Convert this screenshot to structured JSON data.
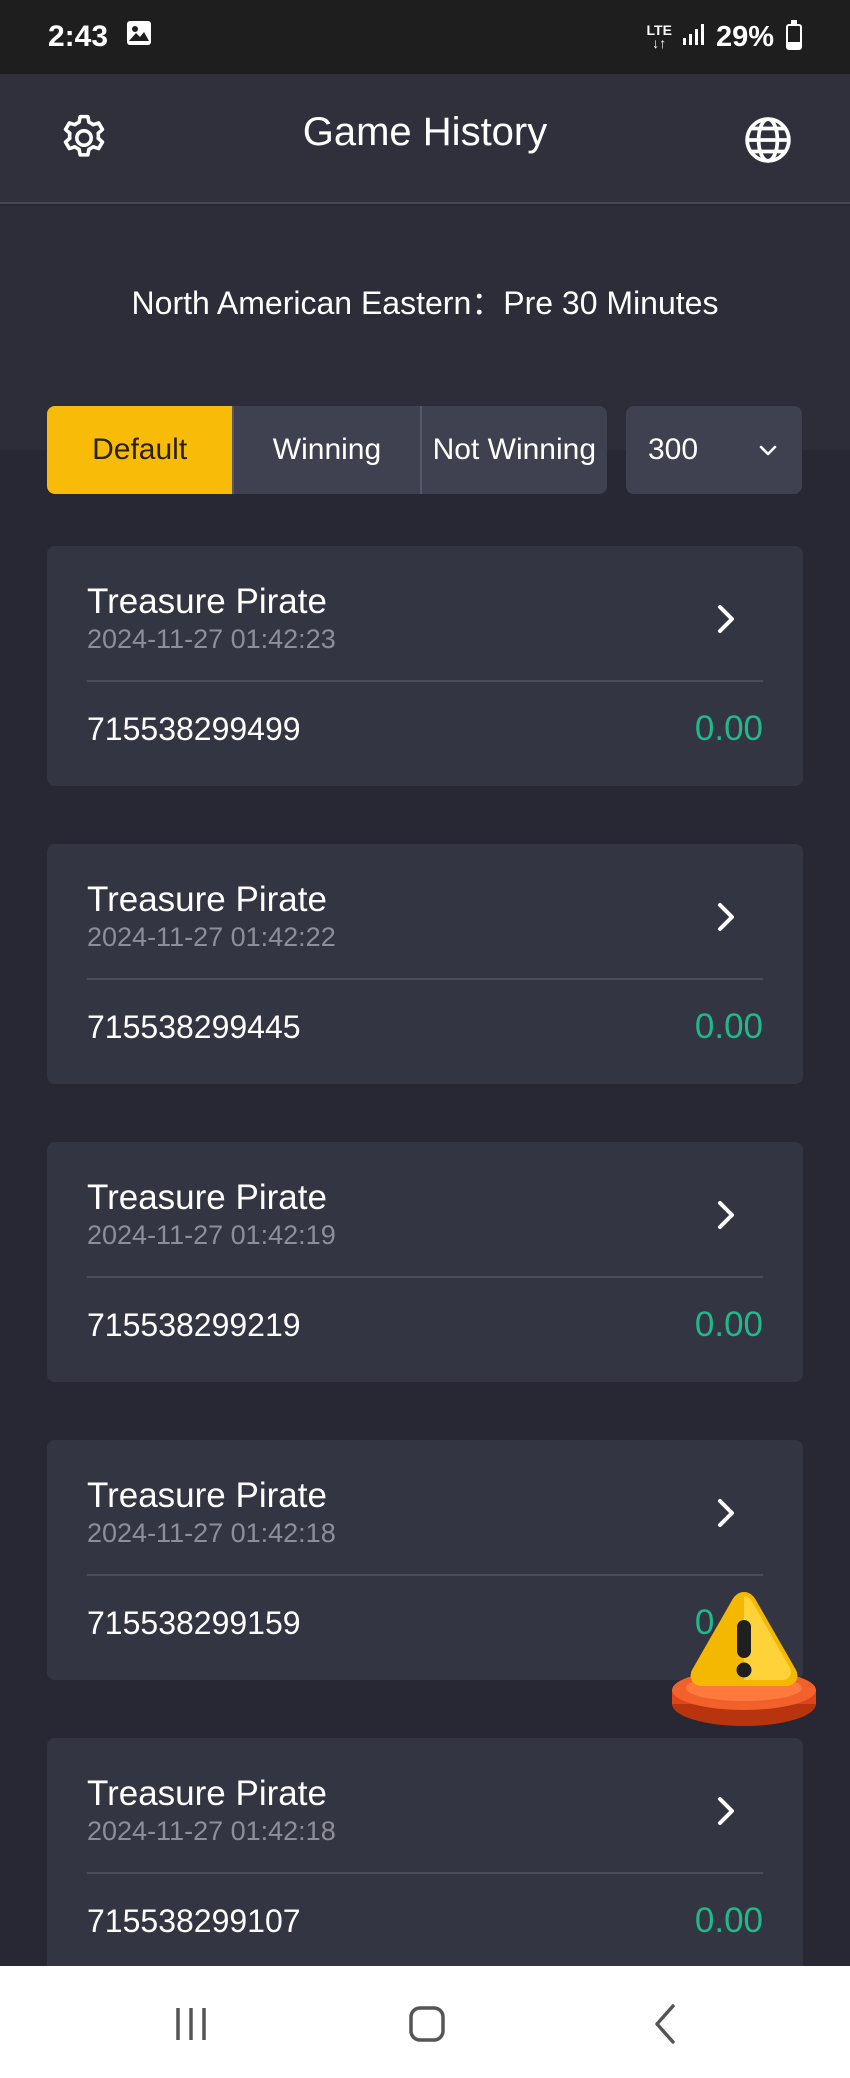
{
  "status_bar": {
    "time": "2:43",
    "network": "LTE",
    "battery": "29%",
    "battery_level": 0.29
  },
  "header": {
    "title": "Game History",
    "settings_icon": "gear-icon",
    "language_icon": "globe-icon"
  },
  "timezone_text": "North American Eastern：Pre 30 Minutes",
  "filters": {
    "tabs": [
      {
        "label": "Default",
        "active": true
      },
      {
        "label": "Winning",
        "active": false
      },
      {
        "label": "Not Winning",
        "active": false
      }
    ],
    "count": {
      "value": "300"
    }
  },
  "records": [
    {
      "game": "Treasure Pirate",
      "time": "2024-11-27 01:42:23",
      "id": "715538299499",
      "amount": "0.00"
    },
    {
      "game": "Treasure Pirate",
      "time": "2024-11-27 01:42:22",
      "id": "715538299445",
      "amount": "0.00"
    },
    {
      "game": "Treasure Pirate",
      "time": "2024-11-27 01:42:19",
      "id": "715538299219",
      "amount": "0.00"
    },
    {
      "game": "Treasure Pirate",
      "time": "2024-11-27 01:42:18",
      "id": "715538299159",
      "amount": "0.00"
    },
    {
      "game": "Treasure Pirate",
      "time": "2024-11-27 01:42:18",
      "id": "715538299107",
      "amount": "0.00"
    }
  ],
  "colors": {
    "accent": "#f7bb08",
    "amount": "#1fb98a",
    "background": "#272833",
    "card": "#343542"
  }
}
